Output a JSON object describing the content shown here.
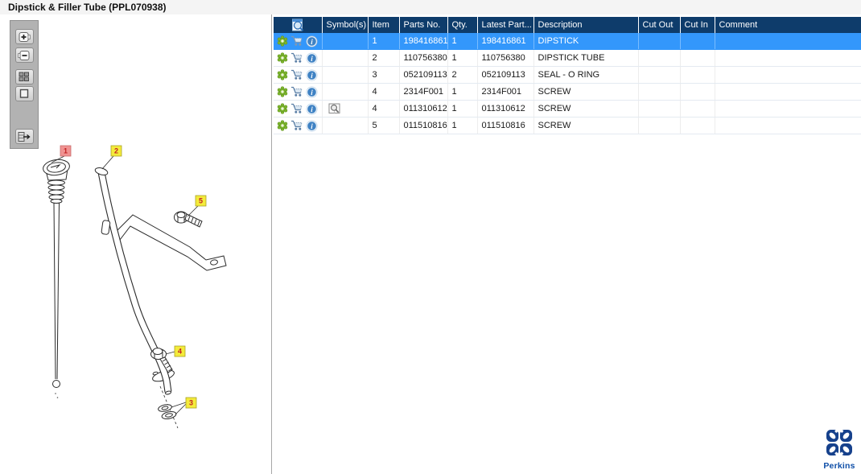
{
  "window": {
    "title": "Dipstick & Filler Tube (PPL070938)"
  },
  "viewer_toolbar": {
    "buttons": [
      {
        "name": "zoom-in",
        "icon": "plus-icon"
      },
      {
        "name": "zoom-out",
        "icon": "minus-icon"
      },
      {
        "name": "tile-view",
        "icon": "grid-icon"
      },
      {
        "name": "fit-view",
        "icon": "square-icon"
      },
      {
        "name": "toggle-panel",
        "icon": "panel-arrow-right-icon"
      }
    ]
  },
  "diagram": {
    "callouts": [
      {
        "number": "1",
        "style": "red",
        "part": "DIPSTICK"
      },
      {
        "number": "2",
        "style": "yellow",
        "part": "DIPSTICK TUBE"
      },
      {
        "number": "3",
        "style": "yellow",
        "part": "SEAL - O RING"
      },
      {
        "number": "4",
        "style": "yellow",
        "part": "SCREW"
      },
      {
        "number": "5",
        "style": "yellow",
        "part": "SCREW"
      }
    ]
  },
  "parts_table": {
    "columns": [
      {
        "label": "",
        "icon": "results-preview-icon"
      },
      {
        "label": "Symbol(s)"
      },
      {
        "label": "Item"
      },
      {
        "label": "Parts No."
      },
      {
        "label": "Qty."
      },
      {
        "label": "Latest Part..."
      },
      {
        "label": "Description"
      },
      {
        "label": "Cut Out"
      },
      {
        "label": "Cut In"
      },
      {
        "label": "Comment"
      }
    ],
    "row_icons": [
      "gear-icon",
      "cart-icon",
      "info-icon"
    ],
    "rows": [
      {
        "item": "1",
        "parts_no": "198416861",
        "qty": "1",
        "latest_part": "198416861",
        "description": "DIPSTICK",
        "cut_out": "",
        "cut_in": "",
        "comment": "",
        "selected": true,
        "has_symbol": false
      },
      {
        "item": "2",
        "parts_no": "110756380",
        "qty": "1",
        "latest_part": "110756380",
        "description": "DIPSTICK TUBE",
        "cut_out": "",
        "cut_in": "",
        "comment": "",
        "selected": false,
        "has_symbol": false
      },
      {
        "item": "3",
        "parts_no": "052109113",
        "qty": "2",
        "latest_part": "052109113",
        "description": "SEAL - O RING",
        "cut_out": "",
        "cut_in": "",
        "comment": "",
        "selected": false,
        "has_symbol": false
      },
      {
        "item": "4",
        "parts_no": "2314F001",
        "qty": "1",
        "latest_part": "2314F001",
        "description": "SCREW",
        "cut_out": "",
        "cut_in": "",
        "comment": "",
        "selected": false,
        "has_symbol": false
      },
      {
        "item": "4",
        "parts_no": "011310612",
        "qty": "1",
        "latest_part": "011310612",
        "description": "SCREW",
        "cut_out": "",
        "cut_in": "",
        "comment": "",
        "selected": false,
        "has_symbol": true,
        "symbol_icon": "book-magnifier-icon"
      },
      {
        "item": "5",
        "parts_no": "011510816",
        "qty": "1",
        "latest_part": "011510816",
        "description": "SCREW",
        "cut_out": "",
        "cut_in": "",
        "comment": "",
        "selected": false,
        "has_symbol": false
      }
    ]
  },
  "branding": {
    "name": "Perkins"
  },
  "colors": {
    "header_bg": "#0e3c6b",
    "selected_row_bg": "#3397fb",
    "callout_yellow": "#f4eb3b",
    "callout_red": "#f09392",
    "gear_green": "#7db62c",
    "logo_blue": "#16418c",
    "toolbar_gray": "#b2b2b2"
  }
}
